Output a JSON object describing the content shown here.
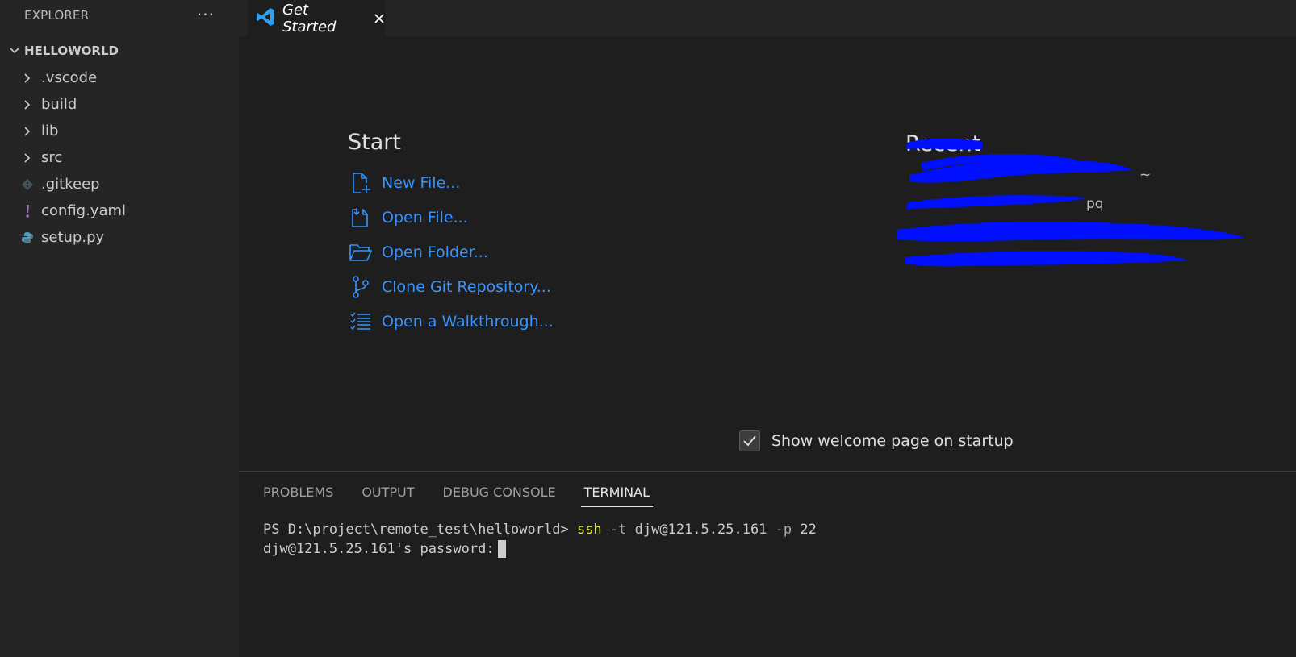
{
  "sidebar": {
    "title": "EXPLORER",
    "more_glyph": "···",
    "folder": "HELLOWORLD",
    "items": [
      {
        "label": ".vscode",
        "icon": "chevron-right-icon"
      },
      {
        "label": "build",
        "icon": "chevron-right-icon"
      },
      {
        "label": "lib",
        "icon": "chevron-right-icon"
      },
      {
        "label": "src",
        "icon": "chevron-right-icon"
      },
      {
        "label": ".gitkeep",
        "icon": "git-icon"
      },
      {
        "label": "config.yaml",
        "icon": "yaml-icon"
      },
      {
        "label": "setup.py",
        "icon": "python-icon"
      }
    ]
  },
  "tab": {
    "title": "Get Started"
  },
  "welcome": {
    "start_title": "Start",
    "start_items": [
      {
        "label": "New File...",
        "icon": "new-file-icon"
      },
      {
        "label": "Open File...",
        "icon": "open-file-icon"
      },
      {
        "label": "Open Folder...",
        "icon": "open-folder-icon"
      },
      {
        "label": "Clone Git Repository...",
        "icon": "git-branch-icon"
      },
      {
        "label": "Open a Walkthrough...",
        "icon": "checklist-icon"
      }
    ],
    "recent_title": "Recent",
    "recent_items": [
      {
        "name": "",
        "path": "~"
      },
      {
        "name": "",
        "path": "pq"
      },
      {
        "name": "",
        "path": ""
      },
      {
        "name": "",
        "path": ""
      }
    ],
    "show_on_startup_label": "Show welcome page on startup",
    "show_on_startup_checked": true
  },
  "panel": {
    "tabs": [
      "PROBLEMS",
      "OUTPUT",
      "DEBUG CONSOLE",
      "TERMINAL"
    ],
    "active_tab": "TERMINAL",
    "terminal": {
      "prompt": "PS D:\\project\\remote_test\\helloworld>",
      "cmd": "ssh",
      "flag_t": "-t",
      "host": "djw@121.5.25.161",
      "flag_p": "-p",
      "port": "22",
      "password_prompt": "djw@121.5.25.161's password:"
    }
  },
  "colors": {
    "accent": "#3794ff",
    "background": "#1e1e1e",
    "sidebar": "#252526",
    "redaction": "#0010ff",
    "terminal_cmd": "#e5e510"
  }
}
